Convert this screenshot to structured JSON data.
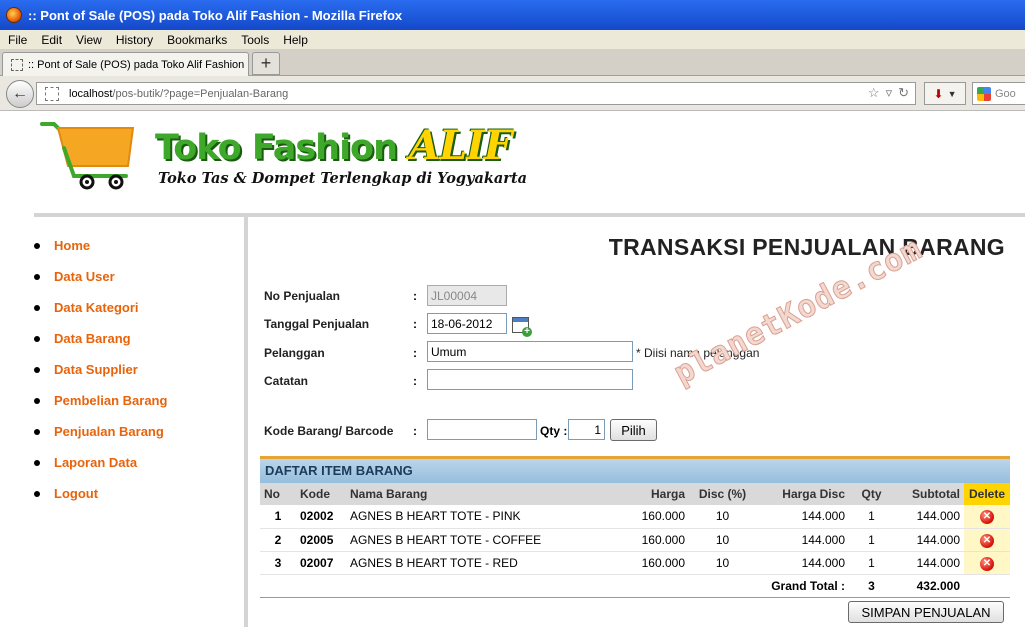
{
  "window": {
    "title": ":: Pont of Sale (POS) pada Toko Alif Fashion - Mozilla Firefox"
  },
  "menu": [
    "File",
    "Edit",
    "View",
    "History",
    "Bookmarks",
    "Tools",
    "Help"
  ],
  "tab": {
    "label": ":: Pont of Sale (POS) pada Toko Alif Fashion",
    "new_tab": "+"
  },
  "address": {
    "host": "localhost",
    "path": "/pos-butik/?page=Penjualan-Barang"
  },
  "search": {
    "placeholder": "Goo"
  },
  "brand": {
    "name": "Toko Fashion",
    "name_accent": "ALIF",
    "tagline": "Toko Tas & Dompet Terlengkap di Yogyakarta"
  },
  "sidebar": {
    "items": [
      {
        "label": "Home"
      },
      {
        "label": "Data User"
      },
      {
        "label": "Data Kategori"
      },
      {
        "label": "Data Barang"
      },
      {
        "label": "Data Supplier"
      },
      {
        "label": "Pembelian Barang"
      },
      {
        "label": "Penjualan Barang"
      },
      {
        "label": "Laporan Data"
      },
      {
        "label": "Logout"
      }
    ]
  },
  "page": {
    "title": "TRANSAKSI PENJUALAN BARANG"
  },
  "form": {
    "colon": ":",
    "no_penjualan": {
      "label": "No Penjualan",
      "value": "JL00004"
    },
    "tanggal": {
      "label": "Tanggal Penjualan",
      "value": "18-06-2012"
    },
    "pelanggan": {
      "label": "Pelanggan",
      "value": "Umum",
      "hint": "* Diisi nama pelanggan"
    },
    "catatan": {
      "label": "Catatan",
      "value": ""
    },
    "kode_barang": {
      "label": "Kode Barang/ Barcode",
      "value": ""
    },
    "qty": {
      "label": "Qty :",
      "value": "1"
    },
    "pilih_label": "Pilih"
  },
  "watermark": "planetKode.com",
  "table": {
    "title": "DAFTAR ITEM BARANG",
    "headers": [
      "No",
      "Kode",
      "Nama Barang",
      "Harga",
      "Disc (%)",
      "Harga Disc",
      "Qty",
      "Subtotal",
      "Delete"
    ],
    "rows": [
      {
        "no": "1",
        "kode": "02002",
        "nama": "AGNES B HEART TOTE - PINK",
        "harga": "160.000",
        "disc": "10",
        "harga_disc": "144.000",
        "qty": "1",
        "subtotal": "144.000"
      },
      {
        "no": "2",
        "kode": "02005",
        "nama": "AGNES B HEART TOTE - COFFEE",
        "harga": "160.000",
        "disc": "10",
        "harga_disc": "144.000",
        "qty": "1",
        "subtotal": "144.000"
      },
      {
        "no": "3",
        "kode": "02007",
        "nama": "AGNES B HEART TOTE - RED",
        "harga": "160.000",
        "disc": "10",
        "harga_disc": "144.000",
        "qty": "1",
        "subtotal": "144.000"
      }
    ],
    "total": {
      "label": "Grand Total :",
      "qty": "3",
      "subtotal": "432.000"
    }
  },
  "save_label": "SIMPAN PENJUALAN",
  "icons": {
    "back": "back-arrow-icon",
    "star": "bookmark-star-icon",
    "reload": "reload-icon",
    "calendar": "calendar-icon",
    "delete": "delete-icon",
    "cart": "shopping-cart-icon"
  },
  "colors": {
    "accent_orange": "#e8630a",
    "brand_green": "#3ea82b",
    "brand_yellow": "#ffd400",
    "table_header_blue": "#95bedd"
  }
}
